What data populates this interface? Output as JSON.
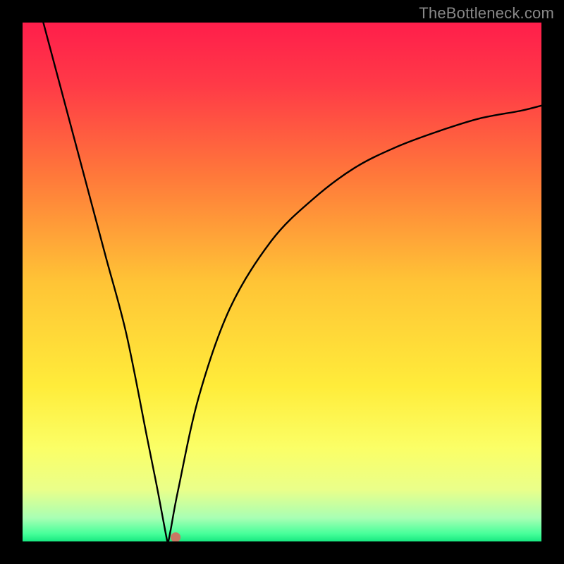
{
  "watermark": "TheBottleneck.com",
  "chart_data": {
    "type": "line",
    "title": "",
    "xlabel": "",
    "ylabel": "",
    "xlim": [
      0,
      100
    ],
    "ylim": [
      0,
      100
    ],
    "grid": false,
    "legend": false,
    "curve": {
      "description": "V-shaped bottleneck curve with minimum near x≈28, left branch near-linear descending from top-left, right branch asymptotically rising",
      "x": [
        4,
        8,
        12,
        16,
        20,
        24,
        26,
        27.5,
        28,
        28.5,
        30,
        34,
        40,
        48,
        56,
        64,
        72,
        80,
        88,
        96,
        100
      ],
      "y": [
        100,
        85,
        70,
        55,
        40,
        20,
        10,
        2,
        0,
        2,
        10,
        28,
        45,
        58,
        66,
        72,
        76,
        79,
        81.5,
        83,
        84
      ]
    },
    "marker": {
      "x": 29.5,
      "y": 0.8,
      "color": "#c97763",
      "radius_px": 7
    },
    "background_gradient": {
      "type": "vertical",
      "stops": [
        {
          "pos": 0.0,
          "color": "#ff1e4b"
        },
        {
          "pos": 0.12,
          "color": "#ff3a47"
        },
        {
          "pos": 0.3,
          "color": "#ff7a3a"
        },
        {
          "pos": 0.5,
          "color": "#ffc436"
        },
        {
          "pos": 0.7,
          "color": "#ffec3a"
        },
        {
          "pos": 0.82,
          "color": "#fbff66"
        },
        {
          "pos": 0.9,
          "color": "#eaff8a"
        },
        {
          "pos": 0.955,
          "color": "#a8ffb4"
        },
        {
          "pos": 0.985,
          "color": "#47ff9a"
        },
        {
          "pos": 1.0,
          "color": "#18e880"
        }
      ]
    }
  }
}
